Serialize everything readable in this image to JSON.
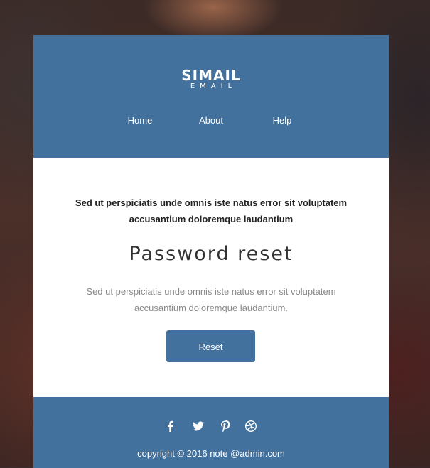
{
  "header": {
    "logo_main": "SIMAIL",
    "logo_sub": "EMAIL",
    "nav": [
      "Home",
      "About",
      "Help"
    ]
  },
  "content": {
    "intro_line1": "Sed ut perspiciatis unde omnis iste natus error sit voluptatem",
    "intro_line2": "accusantium doloremque laudantium",
    "title": "Password reset",
    "desc_line1": "Sed ut perspiciatis unde omnis iste natus error sit voluptatem",
    "desc_line2": "accusantium doloremque laudantium.",
    "button_label": "Reset"
  },
  "footer": {
    "social_icons": [
      "facebook-icon",
      "twitter-icon",
      "pinterest-icon",
      "dribbble-icon"
    ],
    "copyright": "copyright © 2016 note @admin.com"
  },
  "colors": {
    "brand": "#43719e",
    "content_bg": "#ffffff",
    "text_dark": "#222222",
    "text_muted": "#8a8a8a"
  }
}
